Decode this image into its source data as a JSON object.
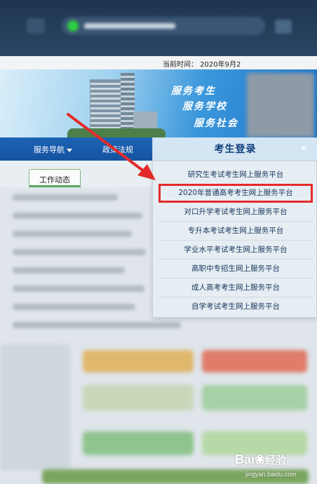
{
  "header": {
    "date_label": "当前时间：",
    "date_value": "2020年9月2"
  },
  "banner": {
    "slogans": [
      "服务考生",
      "服务学校",
      "服务社会"
    ]
  },
  "nav": {
    "items": [
      {
        "label": "服务导航"
      },
      {
        "label": "政策法规"
      }
    ]
  },
  "dropdown": {
    "title": "考生登录",
    "items": [
      {
        "label": "研究生考试考生网上服务平台",
        "highlighted": false
      },
      {
        "label": "2020年普通高考考生网上服务平台",
        "highlighted": true
      },
      {
        "label": "对口升学考试考生网上服务平台",
        "highlighted": false
      },
      {
        "label": "专升本考试考生网上服务平台",
        "highlighted": false
      },
      {
        "label": "学业水平考试考生网上服务平台",
        "highlighted": false
      },
      {
        "label": "高职中专招生网上服务平台",
        "highlighted": false
      },
      {
        "label": "成人高考考生网上服务平台",
        "highlighted": false
      },
      {
        "label": "自学考试考生网上服务平台",
        "highlighted": false
      }
    ]
  },
  "content": {
    "tab_label": "工作动态"
  },
  "annotation": {
    "arrow_color": "#e42a2a",
    "highlight_color": "#e42a2a"
  },
  "watermark": {
    "brand": "Bai",
    "brand_tail": "经验",
    "url": "jingyan.baidu.com"
  }
}
